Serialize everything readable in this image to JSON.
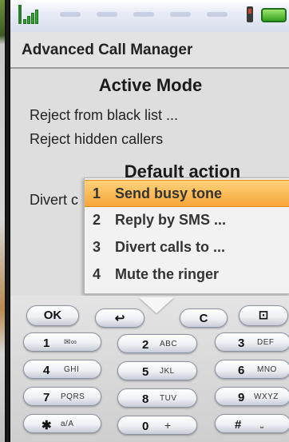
{
  "app": {
    "title": "Advanced Call Manager"
  },
  "active_mode": {
    "heading": "Active Mode",
    "options": [
      "Reject from black list ...",
      "Reject hidden callers"
    ]
  },
  "default_action": {
    "heading": "Default action",
    "current_value": "Divert c"
  },
  "popup_menu": {
    "items": [
      {
        "number": "1",
        "label": "Send busy tone",
        "selected": true
      },
      {
        "number": "2",
        "label": "Reply by SMS ...",
        "selected": false
      },
      {
        "number": "3",
        "label": "Divert calls to ...",
        "selected": false
      },
      {
        "number": "4",
        "label": "Mute the ringer",
        "selected": false
      }
    ]
  },
  "soft_keys": {
    "left": "OK",
    "back": "↩",
    "clear": "C",
    "menu": "⊡"
  },
  "keypad": [
    {
      "digit": "1",
      "letters": "✉∞"
    },
    {
      "digit": "2",
      "letters": "ABC"
    },
    {
      "digit": "3",
      "letters": "DEF"
    },
    {
      "digit": "4",
      "letters": "GHI"
    },
    {
      "digit": "5",
      "letters": "JKL"
    },
    {
      "digit": "6",
      "letters": "MNO"
    },
    {
      "digit": "7",
      "letters": "PQRS"
    },
    {
      "digit": "8",
      "letters": "TUV"
    },
    {
      "digit": "9",
      "letters": "WXYZ"
    },
    {
      "digit": "✱",
      "letters": "a/A"
    },
    {
      "digit": "0",
      "letters": "+"
    },
    {
      "digit": "#",
      "letters": "⎵"
    }
  ],
  "colors": {
    "selection": "#f6a63a",
    "signal": "#2fa52f",
    "battery": "#37a11f"
  },
  "icons": [
    "signal-strength-icon",
    "phone-status-icon",
    "battery-icon",
    "back-arrow-icon",
    "menu-icon",
    "nav-down-arrow-icon"
  ]
}
